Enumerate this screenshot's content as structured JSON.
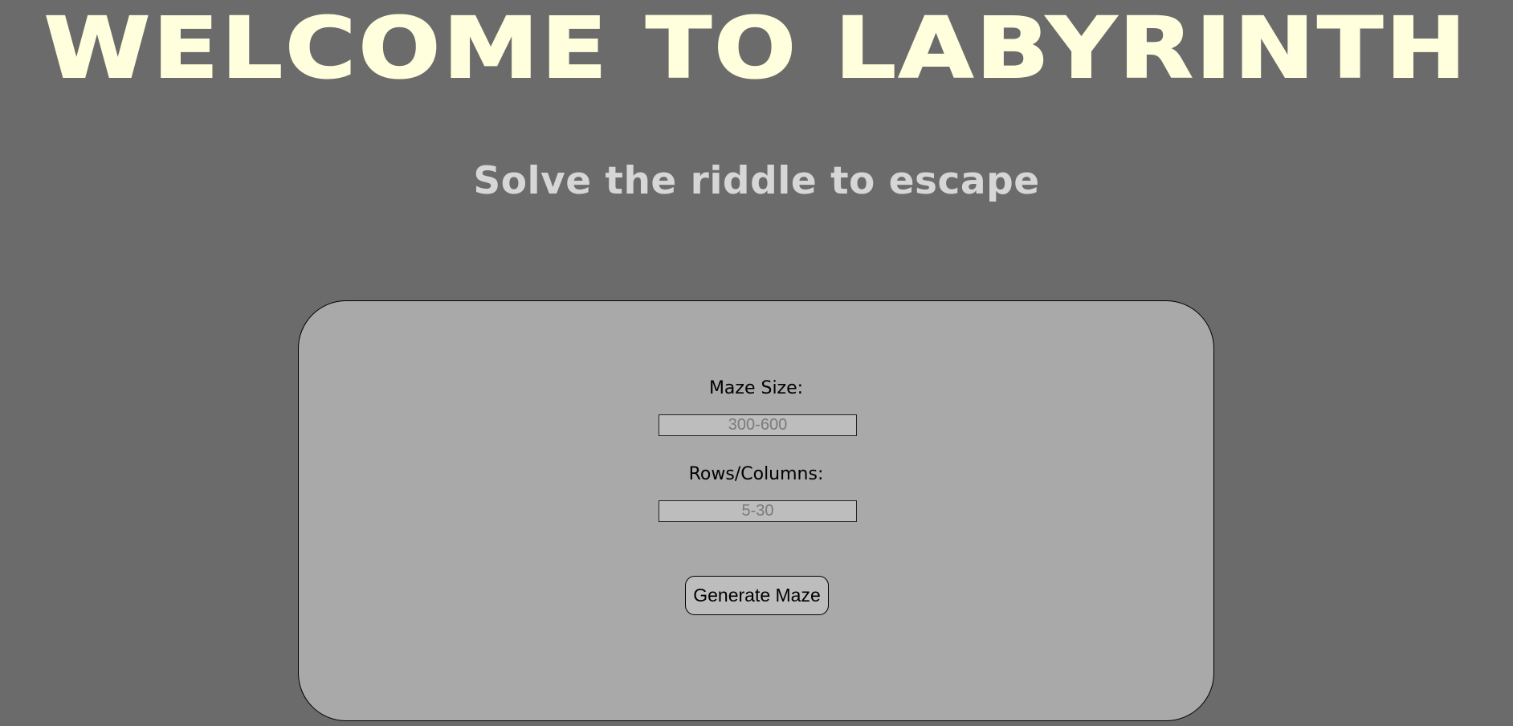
{
  "page": {
    "title": "Welcome to Labyrinth",
    "subtitle": "Solve the riddle to escape"
  },
  "form": {
    "maze_size": {
      "label": "Maze Size:",
      "value": "",
      "placeholder": "300-600"
    },
    "rows_columns": {
      "label": "Rows/Columns:",
      "value": "",
      "placeholder": "5-30"
    },
    "generate_button_label": "Generate Maze"
  },
  "colors": {
    "background": "#6b6b6b",
    "title": "#fffedd",
    "subtitle": "#d6d6d6",
    "panel": "#a9a9a9",
    "input_background": "#bdbdbd"
  }
}
